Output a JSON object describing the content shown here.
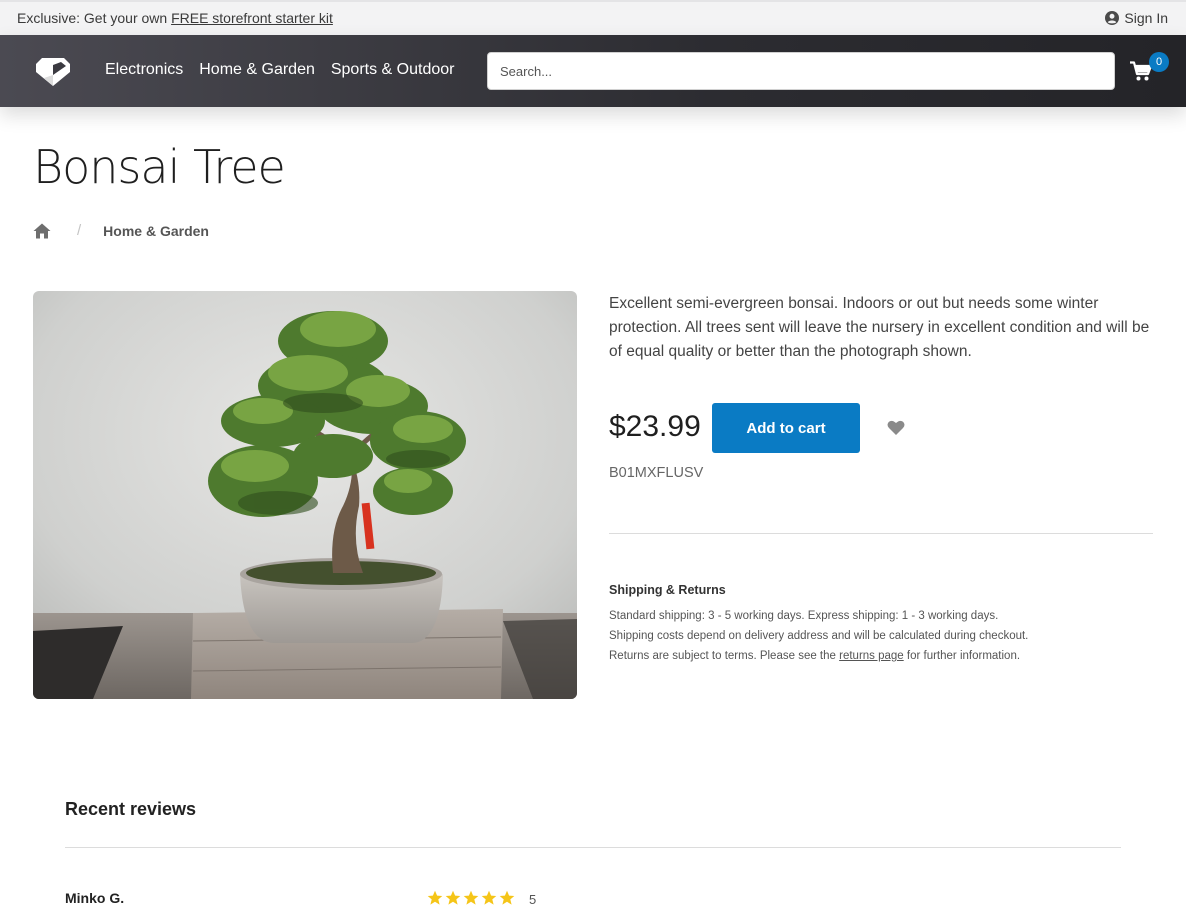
{
  "promo": {
    "text_prefix": "Exclusive: Get your own ",
    "link_text": "FREE storefront starter kit"
  },
  "header": {
    "signin_label": "Sign In",
    "nav_links": [
      "Electronics",
      "Home & Garden",
      "Sports & Outdoor"
    ],
    "search_placeholder": "Search...",
    "cart_count": "0"
  },
  "product": {
    "title": "Bonsai Tree",
    "breadcrumb": [
      "Home & Garden"
    ],
    "description": "Excellent semi-evergreen bonsai. Indoors or out but needs some winter protection. All trees sent will leave the nursery in excellent condition and will be of equal quality or better than the photograph shown.",
    "price": "$23.99",
    "add_to_cart_label": "Add to cart",
    "sku": "B01MXFLUSV"
  },
  "shipping": {
    "title": "Shipping & Returns",
    "line1": "Standard shipping: 3 - 5 working days. Express shipping: 1 - 3 working days.",
    "line2": "Shipping costs depend on delivery address and will be calculated during checkout.",
    "line3_prefix": "Returns are subject to terms. Please see the ",
    "line3_link": "returns page",
    "line3_suffix": " for further information."
  },
  "reviews": {
    "title": "Recent reviews",
    "items": [
      {
        "author": "Minko G.",
        "rating": "5"
      }
    ]
  },
  "colors": {
    "accent": "#0a7bc4",
    "star": "#f5c518",
    "nav_bg": "#2c2c31"
  },
  "icons": [
    "user-circle-icon",
    "logo-icon",
    "cart-icon",
    "home-icon",
    "heart-icon",
    "star-icon"
  ]
}
